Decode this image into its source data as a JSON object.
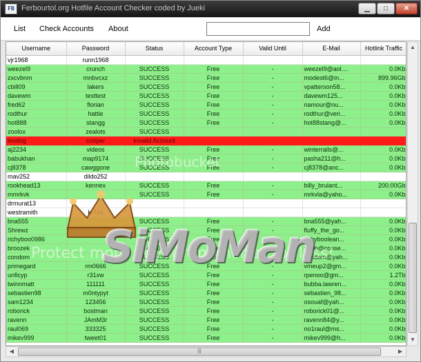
{
  "window": {
    "icon_text": "FB",
    "title": "Ferbourtol.org Hotfile Account Checker coded by Jueki",
    "minimize_glyph": "▁",
    "maximize_glyph": "□",
    "close_glyph": "✕"
  },
  "menu": {
    "list": "List",
    "check": "Check Accounts",
    "about": "About",
    "add_input_value": "",
    "add_label": "Add"
  },
  "table": {
    "headers": [
      "Username",
      "Password",
      "Status",
      "Account Type",
      "Valid Until",
      "E-Mail",
      "Hotlink Traffic"
    ],
    "rows": [
      {
        "style": "white",
        "cells": [
          "vjr1968",
          "runn1968",
          "",
          "",
          "",
          "",
          ""
        ]
      },
      {
        "style": "green",
        "cells": [
          "weezel9",
          "crunch",
          "SUCCESS",
          "Free",
          "-",
          "weezel9@aol....",
          "0.0Kb"
        ]
      },
      {
        "style": "green",
        "cells": [
          "zxcvbnm",
          "mnbvcxz",
          "SUCCESS",
          "Free",
          "-",
          "modest6@in...",
          "899.96Gb"
        ]
      },
      {
        "style": "green",
        "cells": [
          "cbill09",
          "lakers",
          "SUCCESS",
          "Free",
          "-",
          "vpatterson58...",
          "0.0Kb"
        ]
      },
      {
        "style": "green",
        "cells": [
          "davewm",
          "testtest",
          "SUCCESS",
          "Free",
          "-",
          "davewm125...",
          "0.0Kb"
        ]
      },
      {
        "style": "green",
        "cells": [
          "fred62",
          "florian",
          "SUCCESS",
          "Free",
          "-",
          "namour@nu...",
          "0.0Kb"
        ]
      },
      {
        "style": "green",
        "cells": [
          "rodthur",
          "hattie",
          "SUCCESS",
          "Free",
          "-",
          "rodthur@veri...",
          "0.0Kb"
        ]
      },
      {
        "style": "green",
        "cells": [
          "hot888",
          "stangg",
          "SUCCESS",
          "Free",
          "-",
          "hot88stang@...",
          "0.0Kb"
        ]
      },
      {
        "style": "green",
        "cells": [
          "zoolox",
          "zealots",
          "SUCCESS",
          "",
          "",
          "",
          ""
        ]
      },
      {
        "style": "red",
        "cells": [
          "leodog",
          "cooper",
          "Invalid Account",
          "",
          "",
          "",
          ""
        ]
      },
      {
        "style": "green",
        "cells": [
          "aj2234",
          "videos",
          "SUCCESS",
          "Free",
          "-",
          "winterrails@...",
          "0.0Kb"
        ]
      },
      {
        "style": "green",
        "cells": [
          "babukhan",
          "map9174",
          "SUCCESS",
          "Free",
          "-",
          "pasha211@h...",
          "0.0Kb"
        ]
      },
      {
        "style": "green",
        "cells": [
          "cj8378",
          "cawggone",
          "SUCCESS",
          "Free",
          "-",
          "cj8378@anc...",
          "0.0Kb"
        ]
      },
      {
        "style": "white",
        "cells": [
          "mav252",
          "dildo252",
          "",
          "",
          "",
          "",
          ""
        ]
      },
      {
        "style": "green",
        "cells": [
          "rookhead13",
          "kennex",
          "SUCCESS",
          "Free",
          "-",
          "billy_brulant...",
          "200.00Gb"
        ]
      },
      {
        "style": "green",
        "cells": [
          "mmrkvk",
          "",
          "SUCCESS",
          "Free",
          "-",
          "mrkvla@yaho...",
          "0.0Kb"
        ]
      },
      {
        "style": "white",
        "cells": [
          "drmurat13",
          "",
          "",
          "",
          "",
          "",
          ""
        ]
      },
      {
        "style": "white",
        "cells": [
          "westramith",
          "kr74s",
          "",
          "",
          "",
          "",
          ""
        ]
      },
      {
        "style": "green",
        "cells": [
          "bna555",
          "",
          "SUCCESS",
          "Free",
          "-",
          "bna555@yah...",
          "0.0Kb"
        ]
      },
      {
        "style": "green",
        "cells": [
          "Shrewz",
          "",
          "SUCCESS",
          "Free",
          "-",
          "fluffy_the_go...",
          "0.0Kb"
        ]
      },
      {
        "style": "green",
        "cells": [
          "richyboo0986",
          "",
          "SUCCESS",
          "Free",
          "-",
          "richyboolean...",
          "0.0Kb"
        ]
      },
      {
        "style": "green",
        "cells": [
          "broozek",
          "",
          "SUCCESS",
          "Free",
          "-",
          "ndun@conse...",
          "0.0Kb"
        ]
      },
      {
        "style": "green",
        "cells": [
          "condom",
          "",
          "SUCCESS",
          "Free",
          "-",
          "condom@yah...",
          "0.0Kb"
        ]
      },
      {
        "style": "green",
        "cells": [
          "primegard",
          "rm0666",
          "SUCCESS",
          "Free",
          "-",
          "vmeup2@gm...",
          "0.0Kb"
        ]
      },
      {
        "style": "green",
        "cells": [
          "unficyp",
          "r31xw",
          "SUCCESS",
          "Free",
          "-",
          "rpenoo@gm...",
          "1.2Tb"
        ]
      },
      {
        "style": "green",
        "cells": [
          "twinnmatt",
          "111111",
          "SUCCESS",
          "Free",
          "-",
          "bubba.lawren...",
          "0.0Kb"
        ]
      },
      {
        "style": "green",
        "cells": [
          "sebastien98",
          "m0ntypyt",
          "SUCCESS",
          "Free",
          "-",
          "sebastien_98...",
          "0.0Kb"
        ]
      },
      {
        "style": "green",
        "cells": [
          "sam1234",
          "123456",
          "SUCCESS",
          "Free",
          "-",
          "osouaf@yah...",
          "0.0Kb"
        ]
      },
      {
        "style": "green",
        "cells": [
          "roborick",
          "bostman",
          "SUCCESS",
          "Free",
          "-",
          "roborick01@...",
          "0.0Kb"
        ]
      },
      {
        "style": "green",
        "cells": [
          "ravenn",
          "JAmM3r",
          "SUCCESS",
          "Free",
          "-",
          "ravenn84@y...",
          "0.0Kb"
        ]
      },
      {
        "style": "green",
        "cells": [
          "raul069",
          "333325",
          "SUCCESS",
          "Free",
          "-",
          "no1raul@ms...",
          "0.0Kb"
        ]
      },
      {
        "style": "green",
        "cells": [
          "mikev999",
          "tweet01",
          "SUCCESS",
          "Free",
          "-",
          "mikev999@h...",
          "0.0Kb"
        ]
      }
    ]
  },
  "scrollbar": {
    "up_glyph": "▲",
    "down_glyph": "▼",
    "left_glyph": "◀",
    "right_glyph": "▶",
    "grip": "|||"
  },
  "watermark": {
    "upper": "Photobucket",
    "lower": "Protect more of your memories for less!",
    "logo": "SiMoMan"
  }
}
